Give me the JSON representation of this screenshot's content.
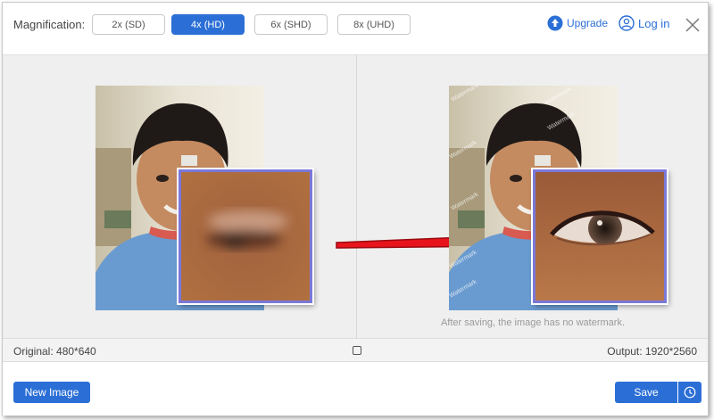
{
  "toolbar": {
    "magnification_label": "Magnification:",
    "options": [
      "2x (SD)",
      "4x (HD)",
      "6x (SHD)",
      "8x (UHD)"
    ],
    "selected": "4x (HD)",
    "upgrade_label": "Upgrade",
    "login_label": "Log in"
  },
  "preview": {
    "watermark_text": "Watermark",
    "note": "After saving, the image has no watermark."
  },
  "info": {
    "original": "Original: 480*640",
    "output": "Output: 1920*2560"
  },
  "actions": {
    "new_image_label": "New Image",
    "save_label": "Save"
  },
  "colors": {
    "accent": "#2b6fd6",
    "zoom_border": "#7a78d8",
    "arrow": "#e8141c"
  }
}
